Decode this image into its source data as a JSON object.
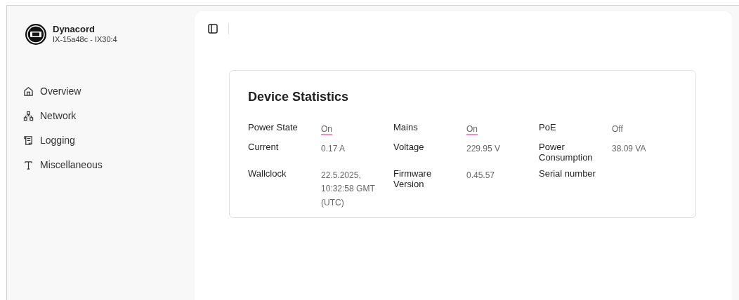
{
  "device": {
    "brand": "Dynacord",
    "model": "IX-15a48c - IX30:4"
  },
  "sidebar": {
    "items": [
      {
        "label": "Overview"
      },
      {
        "label": "Network"
      },
      {
        "label": "Logging"
      },
      {
        "label": "Miscellaneous"
      }
    ]
  },
  "card": {
    "title": "Device Statistics",
    "stats": [
      {
        "label": "Power State",
        "value": "On",
        "kind": "status",
        "on": true
      },
      {
        "label": "Mains",
        "value": "On",
        "kind": "status",
        "on": true
      },
      {
        "label": "PoE",
        "value": "Off",
        "kind": "status",
        "on": false
      },
      {
        "label": "Current",
        "value": "0.17 A",
        "kind": "text"
      },
      {
        "label": "Voltage",
        "value": "229.95 V",
        "kind": "text"
      },
      {
        "label": "Power Consumption",
        "value": "38.09 VA",
        "kind": "text"
      },
      {
        "label": "Wallclock",
        "value": "22.5.2025, 10:32:58 GMT (UTC)",
        "kind": "text"
      },
      {
        "label": "Firmware Version",
        "value": "0.45.57",
        "kind": "text"
      },
      {
        "label": "Serial number"
      }
    ]
  }
}
